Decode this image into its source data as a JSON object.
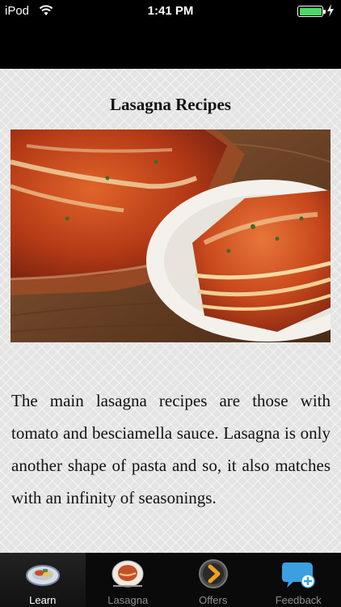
{
  "status_bar": {
    "carrier": "iPod",
    "time": "1:41 PM",
    "battery_color": "#4cd964"
  },
  "content": {
    "title": "Lasagna Recipes",
    "image_icon": "lasagna-photo",
    "body": "The main lasagna recipes are those with tomato and besciamella sauce. Lasagna is only another shape of pasta and so, it also matches with an infinity of seasonings."
  },
  "tab_bar": {
    "items": [
      {
        "label": "Learn",
        "icon": "plate-icon",
        "active": true
      },
      {
        "label": "Lasagna",
        "icon": "dish-icon",
        "active": false
      },
      {
        "label": "Offers",
        "icon": "chevron-circle-icon",
        "active": false
      },
      {
        "label": "Feedback",
        "icon": "speech-bubble-plus-icon",
        "active": false
      }
    ]
  }
}
